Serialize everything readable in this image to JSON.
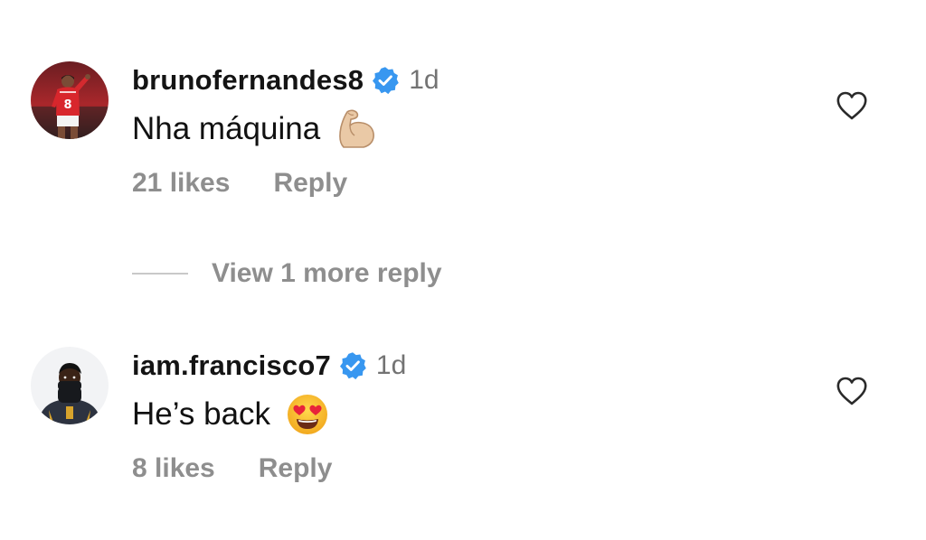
{
  "comments": [
    {
      "username": "brunofernandes8",
      "verified": true,
      "time": "1d",
      "text": "Nha máquina",
      "emoji": "flexed-biceps-light-skin-tone",
      "likes": "21 likes",
      "reply_label": "Reply",
      "avatar": "red-football-jersey-number-8"
    },
    {
      "username": "iam.francisco7",
      "verified": true,
      "time": "1d",
      "text": "He’s back",
      "emoji": "smiling-face-with-heart-eyes",
      "likes": "8 likes",
      "reply_label": "Reply",
      "avatar": "player-with-black-neck-warmer"
    }
  ],
  "view_replies_label": "View 1 more reply",
  "icons": {
    "verified": "verified-badge-icon",
    "like": "heart-outline-icon"
  },
  "colors": {
    "verified_blue": "#3897f0",
    "muted_text": "#8e8e8e",
    "time_text": "#737373"
  }
}
